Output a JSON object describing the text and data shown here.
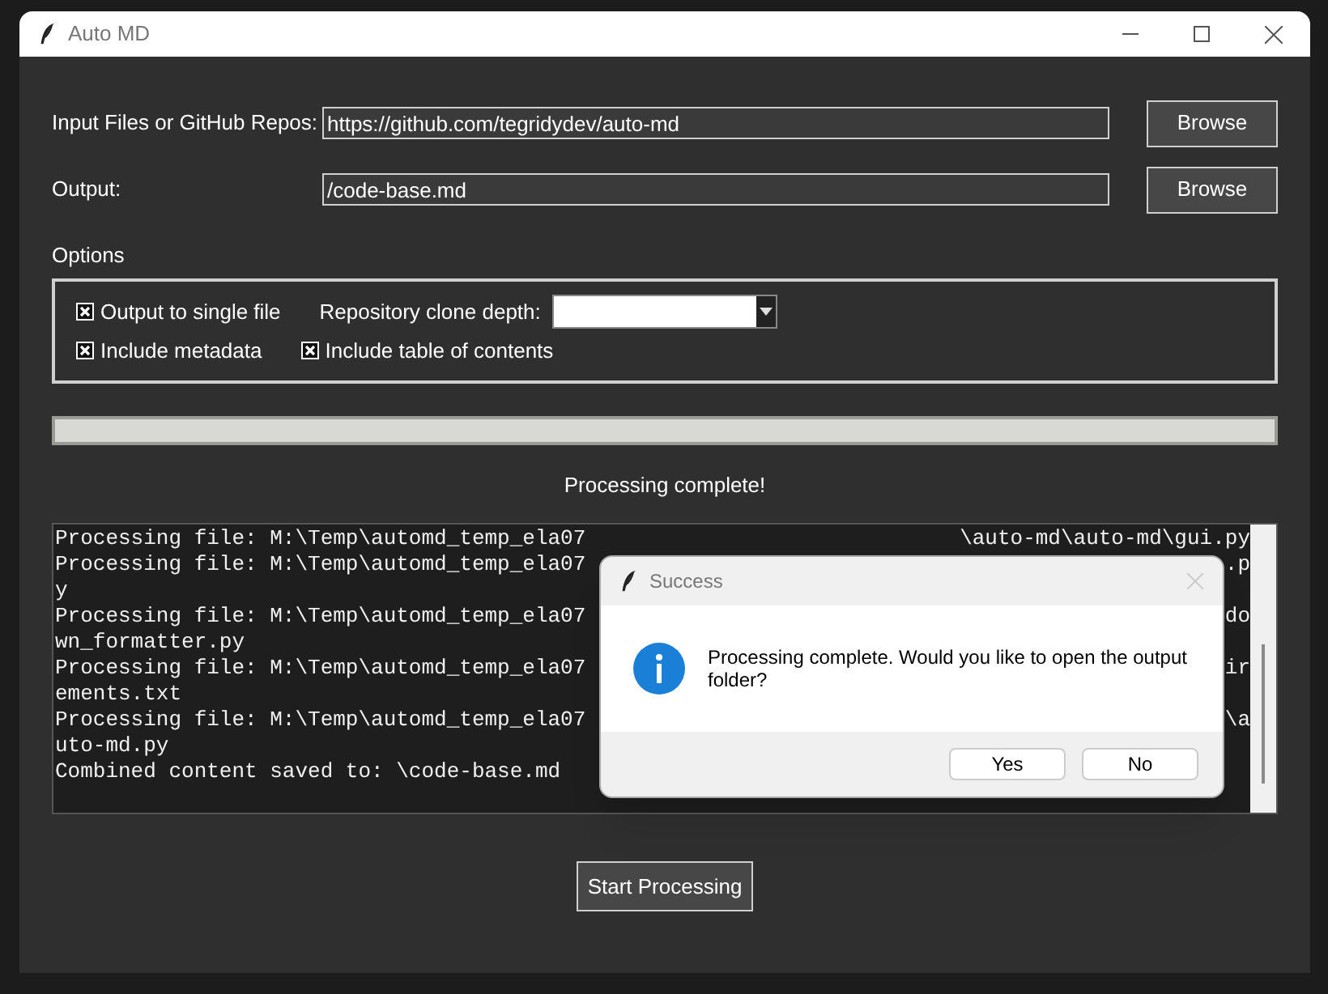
{
  "window": {
    "title": "Auto MD"
  },
  "fields": [
    {
      "label": "Input Files or GitHub Repos:",
      "value": "https://github.com/tegridydev/auto-md",
      "button": "Browse"
    },
    {
      "label": "Output:",
      "value": "/code-base.md",
      "button": "Browse"
    }
  ],
  "options": {
    "title": "Options",
    "rows": [
      [
        {
          "kind": "checkbox",
          "label": "Output to single file",
          "checked": true
        },
        {
          "kind": "combo",
          "label": "Repository clone depth:"
        }
      ],
      [
        {
          "kind": "checkbox",
          "label": "Include metadata",
          "checked": true
        },
        {
          "kind": "checkbox",
          "label": "Include table of contents",
          "checked": true
        }
      ]
    ]
  },
  "progress": {
    "level": 0
  },
  "status": "Processing complete!",
  "log": [
    {
      "left": "Processing file: M:\\Temp\\automd_temp_ela07",
      "right": "\\auto-md\\auto-md\\gui.py"
    },
    {
      "left": "Processing file: M:\\Temp\\automd_temp_ela07",
      "right": ".p"
    },
    {
      "left": "y"
    },
    {
      "left": "Processing file: M:\\Temp\\automd_temp_ela07",
      "right": "do"
    },
    {
      "left": "wn_formatter.py"
    },
    {
      "left": "Processing file: M:\\Temp\\automd_temp_ela07",
      "right": "ir"
    },
    {
      "left": "ements.txt"
    },
    {
      "left": "Processing file: M:\\Temp\\automd_temp_ela07",
      "right": "\\a"
    },
    {
      "left": "uto-md.py"
    },
    {
      "left": "Combined content saved to: \\code-base.md"
    }
  ],
  "dialog": {
    "title": "Success",
    "message": "Processing complete. Would you like to open the output folder?",
    "buttons": [
      "Yes",
      "No"
    ]
  },
  "start_button": "Start Processing"
}
